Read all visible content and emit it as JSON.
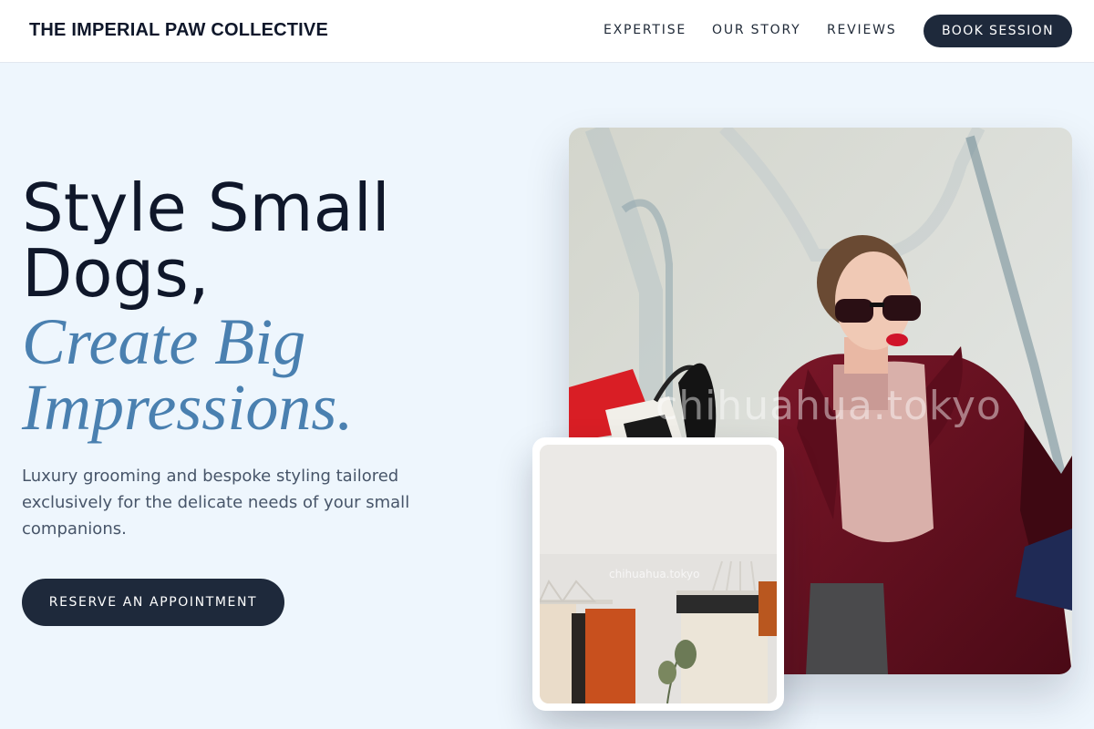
{
  "header": {
    "brand": "THE IMPERIAL PAW COLLECTIVE",
    "nav": {
      "expertise": "EXPERTISE",
      "story": "OUR STORY",
      "reviews": "REVIEWS"
    },
    "cta": "BOOK SESSION"
  },
  "hero": {
    "title_line1": "Style Small",
    "title_line2": "Dogs,",
    "italic_line1": "Create Big",
    "italic_line2": "Impressions.",
    "lead": "Luxury grooming and bespoke styling tailored exclusively for the delicate needs of your small companions.",
    "cta": "RESERVE AN APPOINTMENT"
  },
  "images": {
    "main_watermark": "chihuahua.tokyo",
    "secondary_watermark": "chihuahua.tokyo"
  },
  "colors": {
    "page_bg": "#eef6fd",
    "accent_italic": "#4a80b0",
    "button_dark": "#1e293b"
  }
}
